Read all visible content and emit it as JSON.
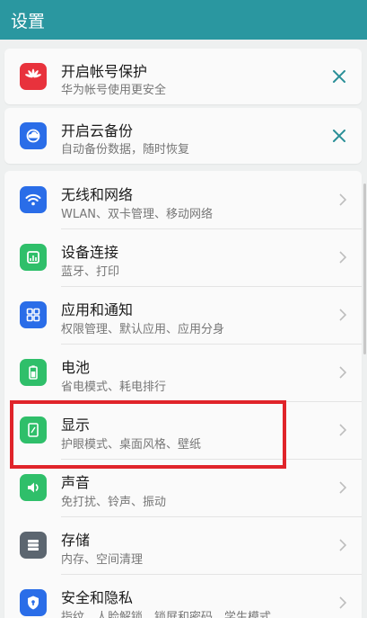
{
  "header": {
    "title": "设置"
  },
  "suggestions": [
    {
      "label": "开启帐号保护",
      "sub": "华为帐号使用更安全",
      "icon": "huawei-logo-icon"
    },
    {
      "label": "开启云备份",
      "sub": "自动备份数据，随时恢复",
      "icon": "cloud-backup-icon"
    }
  ],
  "settings": [
    {
      "label": "无线和网络",
      "sub": "WLAN、双卡管理、移动网络",
      "icon": "wifi-icon"
    },
    {
      "label": "设备连接",
      "sub": "蓝牙、打印",
      "icon": "device-connection-icon"
    },
    {
      "label": "应用和通知",
      "sub": "权限管理、默认应用、应用分身",
      "icon": "apps-icon"
    },
    {
      "label": "电池",
      "sub": "省电模式、耗电排行",
      "icon": "battery-icon"
    },
    {
      "label": "显示",
      "sub": "护眼模式、桌面风格、壁纸",
      "icon": "display-icon"
    },
    {
      "label": "声音",
      "sub": "免打扰、铃声、振动",
      "icon": "sound-icon"
    },
    {
      "label": "存储",
      "sub": "内存、空间清理",
      "icon": "storage-icon"
    },
    {
      "label": "安全和隐私",
      "sub": "指纹、人脸解锁、锁屏和密码、学生模式",
      "icon": "security-icon"
    }
  ],
  "colors": {
    "header": "#2a97a0",
    "highlight": "#e0242a",
    "huawei": "#e8323c",
    "blue": "#2a6de8",
    "green": "#2fbf6a"
  }
}
